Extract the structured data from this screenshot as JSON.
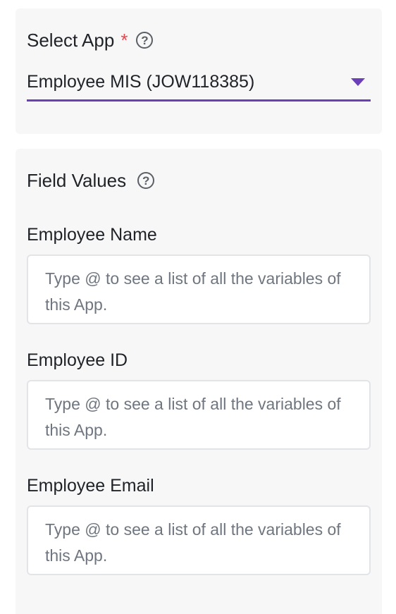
{
  "select_app": {
    "label": "Select App",
    "required_mark": "*",
    "help_icon": "question-circle-icon",
    "value": "Employee MIS (JOW118385)",
    "accent_color": "#6b3fb8"
  },
  "field_values": {
    "title": "Field Values",
    "help_icon": "question-circle-icon",
    "fields": [
      {
        "label": "Employee Name",
        "placeholder": "Type @ to see a list of all the variables of this App."
      },
      {
        "label": "Employee ID",
        "placeholder": "Type @ to see a list of all the variables of this App."
      },
      {
        "label": "Employee Email",
        "placeholder": "Type @ to see a list of all the variables of this App."
      }
    ]
  }
}
